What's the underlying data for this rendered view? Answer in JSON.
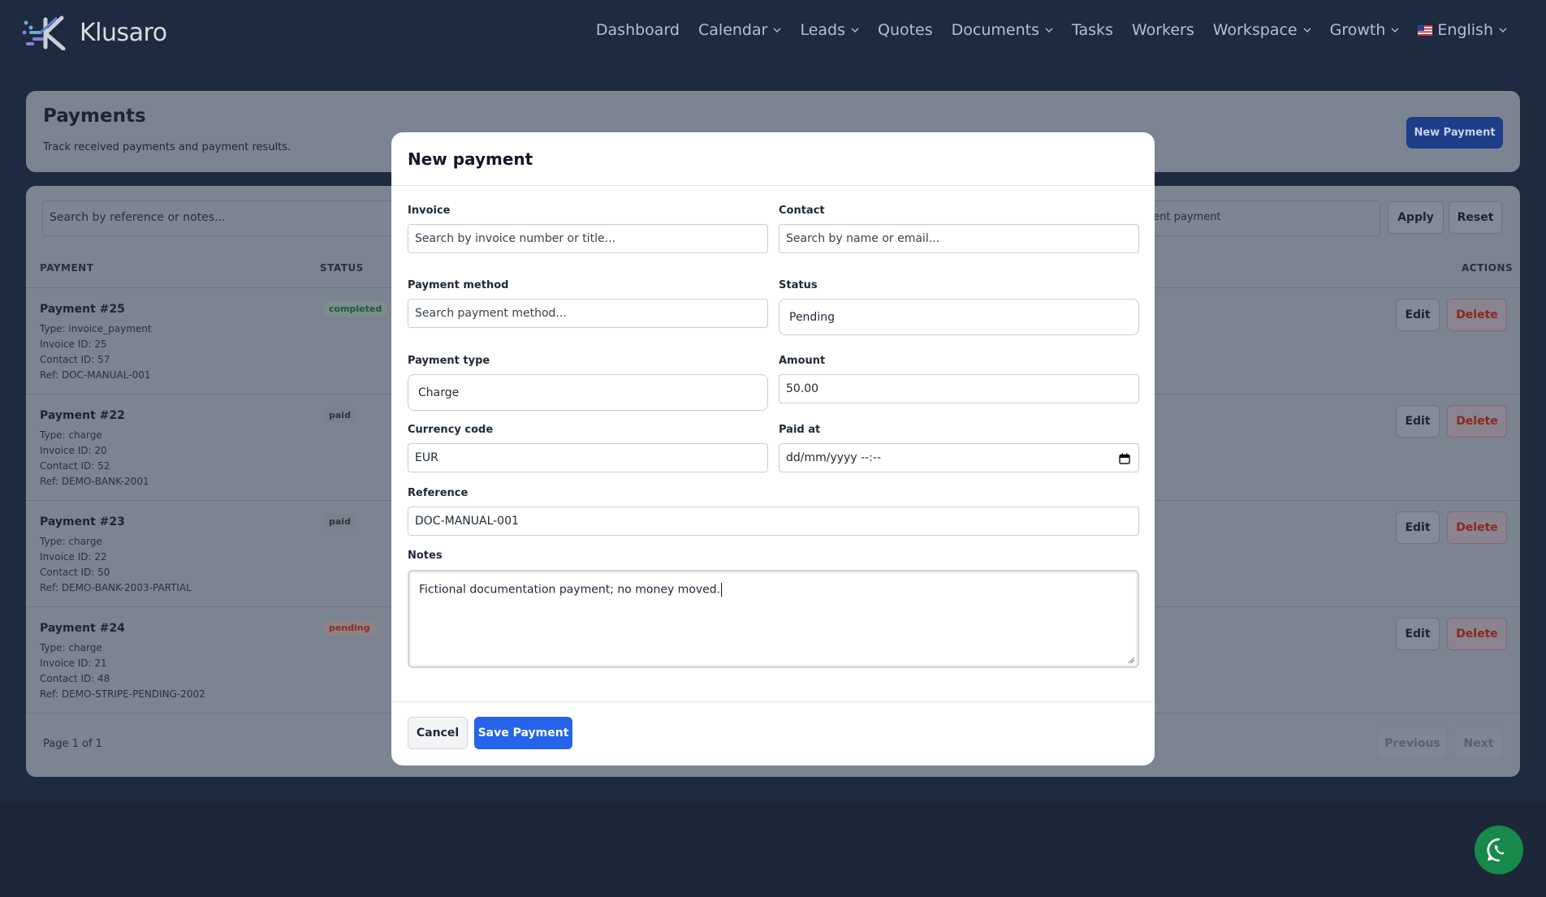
{
  "brand": {
    "name": "Klusaro"
  },
  "nav": {
    "items": [
      {
        "label": "Dashboard",
        "dropdown": false
      },
      {
        "label": "Calendar",
        "dropdown": true
      },
      {
        "label": "Leads",
        "dropdown": true
      },
      {
        "label": "Quotes",
        "dropdown": false
      },
      {
        "label": "Documents",
        "dropdown": true
      },
      {
        "label": "Tasks",
        "dropdown": false
      },
      {
        "label": "Workers",
        "dropdown": false
      },
      {
        "label": "Workspace",
        "dropdown": true
      },
      {
        "label": "Growth",
        "dropdown": true
      }
    ],
    "language": {
      "label": "English",
      "flag_icon": "us-flag-icon"
    }
  },
  "header": {
    "title": "Payments",
    "subtitle": "Track received payments and payment results.",
    "new_button": "New Payment"
  },
  "filters": {
    "search_placeholder": "Search by reference or notes...",
    "status_value": "cent payment",
    "apply_label": "Apply",
    "reset_label": "Reset"
  },
  "table": {
    "columns": {
      "payment": "PAYMENT",
      "status": "STATUS",
      "actions": "ACTIONS"
    },
    "rows": [
      {
        "title": "Payment #25",
        "type": "Type: invoice_payment",
        "invoice": "Invoice ID: 25",
        "contact": "Contact ID: 57",
        "ref": "Ref: DOC-MANUAL-001",
        "status": "completed"
      },
      {
        "title": "Payment #22",
        "type": "Type: charge",
        "invoice": "Invoice ID: 20",
        "contact": "Contact ID: 52",
        "ref": "Ref: DEMO-BANK-2001",
        "status": "paid"
      },
      {
        "title": "Payment #23",
        "type": "Type: charge",
        "invoice": "Invoice ID: 22",
        "contact": "Contact ID: 50",
        "ref": "Ref: DEMO-BANK-2003-PARTIAL",
        "status": "paid"
      },
      {
        "title": "Payment #24",
        "type": "Type: charge",
        "invoice": "Invoice ID: 21",
        "contact": "Contact ID: 48",
        "ref": "Ref: DEMO-STRIPE-PENDING-2002",
        "status": "pending"
      }
    ],
    "edit_label": "Edit",
    "delete_label": "Delete"
  },
  "pagination": {
    "info": "Page 1 of 1",
    "previous": "Previous",
    "next": "Next"
  },
  "modal": {
    "title": "New payment",
    "invoice": {
      "label": "Invoice",
      "placeholder": "Search by invoice number or title..."
    },
    "contact": {
      "label": "Contact",
      "placeholder": "Search by name or email..."
    },
    "payment_method": {
      "label": "Payment method",
      "placeholder": "Search payment method..."
    },
    "status": {
      "label": "Status",
      "value": "Pending"
    },
    "payment_type": {
      "label": "Payment type",
      "value": "Charge"
    },
    "amount": {
      "label": "Amount",
      "value": "50.00"
    },
    "currency": {
      "label": "Currency code",
      "value": "EUR"
    },
    "paid_at": {
      "label": "Paid at",
      "value": "dd/mm/yyyy --:--"
    },
    "reference": {
      "label": "Reference",
      "value": "DOC-MANUAL-001"
    },
    "notes": {
      "label": "Notes",
      "value": "Fictional documentation payment; no money moved."
    },
    "cancel_label": "Cancel",
    "save_label": "Save Payment"
  },
  "colors": {
    "primary": "#2563eb",
    "nav_bg": "#1e2a3f",
    "whatsapp": "#178a4b"
  }
}
